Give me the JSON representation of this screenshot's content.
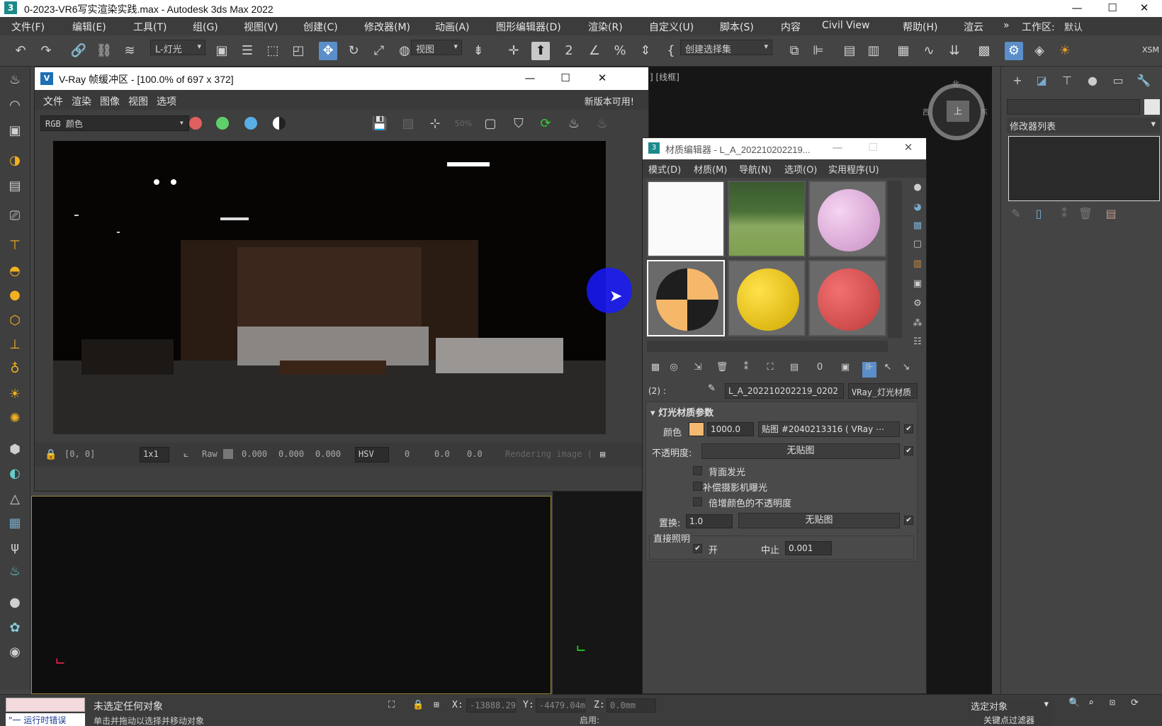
{
  "window": {
    "title": "0-2023-VR6写实渲染实践.max - Autodesk 3ds Max 2022",
    "app_icon": "3",
    "controls": [
      "—",
      "☐",
      "✕"
    ]
  },
  "menubar": {
    "items": [
      "文件(F)",
      "编辑(E)",
      "工具(T)",
      "组(G)",
      "视图(V)",
      "创建(C)",
      "修改器(M)",
      "动画(A)",
      "图形编辑器(D)",
      "渲染(R)",
      "自定义(U)",
      "脚本(S)",
      "内容",
      "Civil View",
      "帮助(H)",
      "渲云"
    ],
    "overflow": "»",
    "workspace_label": "工作区:",
    "workspace_value": "默认"
  },
  "toolbar": {
    "layer_dropdown": "L-灯光",
    "ref_coord_dropdown": "视图",
    "selection_set_dropdown": "创建选择集",
    "right_label": "XSM"
  },
  "vfb": {
    "title": "V-Ray 帧缓冲区 - [100.0% of 697 x 372]",
    "menu": [
      "文件",
      "渲染",
      "图像",
      "视图",
      "选项"
    ],
    "update_notice": "新版本可用!",
    "channel": "RGB 颜色",
    "channel_dots": {
      "red": "#e06060",
      "green": "#5fcf6a",
      "blue": "#5aaee6"
    },
    "status": {
      "coords": "[0, 0]",
      "zoom": "1x1",
      "raw_label": "Raw",
      "rgb_values": [
        "0.000",
        "0.000",
        "0.000"
      ],
      "color_mode": "HSV",
      "hsv_values": [
        "0",
        "0.0",
        "0.0"
      ],
      "progress_text": "Rendering image ("
    }
  },
  "viewport": {
    "label": "用] [线框]",
    "viewcube": {
      "face": "上",
      "north": "北",
      "west": "西",
      "east": "东"
    }
  },
  "material_editor": {
    "title": "材质编辑器 - L_A_202210202219...",
    "menu": [
      "模式(D)",
      "材质(M)",
      "导航(N)",
      "选项(O)",
      "实用程序(U)"
    ],
    "slots": [
      {
        "type": "white-texture",
        "color": "#f2f2f2"
      },
      {
        "type": "grass-photo",
        "color": "#7fa050"
      },
      {
        "type": "sphere",
        "color": "#e6b3e0"
      },
      {
        "type": "checker-sphere",
        "color": "#f5b86a"
      },
      {
        "type": "sphere",
        "color": "#f2cc10"
      },
      {
        "type": "sphere",
        "color": "#e05050"
      }
    ],
    "slot_index_label": "(2)  :",
    "material_name": "L_A_202210202219_0202",
    "material_type": "VRay_灯光材质",
    "rollout_title": "灯光材质参数",
    "color_label": "颜色",
    "color_swatch": "#f5b870",
    "color_multiplier": "1000.0",
    "texmap_label": "贴图 #2040213316 ( VRay ⋯",
    "opacity_label": "不透明度:",
    "opacity_map": "无贴图",
    "emit_backside": "背面发光",
    "compensate_exposure": "补偿摄影机曝光",
    "multiply_opacity": "倍增颜色的不透明度",
    "displace_label": "置换:",
    "displace_value": "1.0",
    "displace_map": "无贴图",
    "direct_illum_label": "直接照明",
    "direct_on_label": "开",
    "cutoff_label": "中止",
    "cutoff_value": "0.001"
  },
  "command_panel": {
    "modifier_list": "修改器列表"
  },
  "statusbar": {
    "listener_text": "\"一 运行时错误",
    "selection_status": "未选定任何对象",
    "prompt": "单击并拖动以选择并移动对象",
    "x_label": "X:",
    "x_value": "-13888.29",
    "y_label": "Y:",
    "y_value": "-4479.04m",
    "z_label": "Z:",
    "z_value": "0.0mm",
    "selection_filter": "选定对象",
    "key_filter": "关键点过滤器",
    "enable_label": "启用:"
  }
}
